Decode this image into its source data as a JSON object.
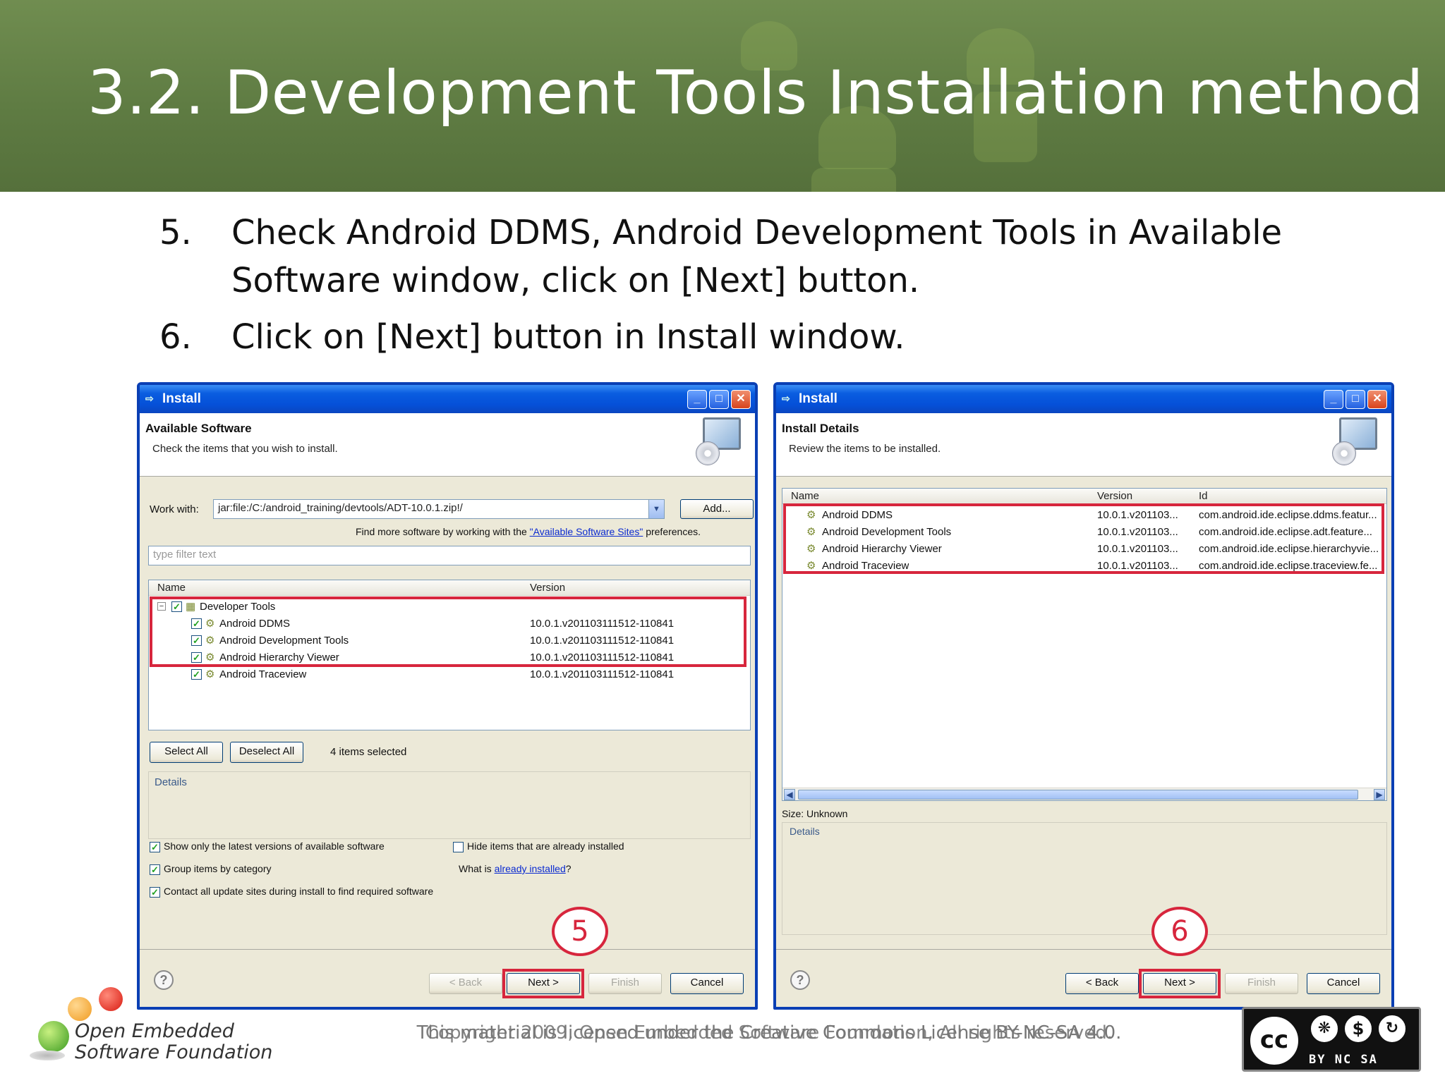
{
  "slide": {
    "title": "3.2. Development Tools Installation method",
    "steps": [
      {
        "num": "5.",
        "text": "Check Android DDMS, Android Development Tools in Available Software window, click on [Next] button."
      },
      {
        "num": "6.",
        "text": "Click on [Next] button in Install window."
      }
    ]
  },
  "left_window": {
    "title": "Install",
    "banner_title": "Available Software",
    "banner_sub": "Check the items that you wish to install.",
    "work_with_label": "Work with:",
    "work_with_value": "jar:file:/C:/android_training/devtools/ADT-10.0.1.zip!/",
    "add_button": "Add...",
    "find_more_prefix": "Find more software by working with the ",
    "find_more_link": "\"Available Software Sites\"",
    "find_more_suffix": " preferences.",
    "filter_placeholder": "type filter text",
    "columns": [
      "Name",
      "Version"
    ],
    "group": "Developer Tools",
    "items": [
      {
        "name": "Android DDMS",
        "version": "10.0.1.v201103111512-110841"
      },
      {
        "name": "Android Development Tools",
        "version": "10.0.1.v201103111512-110841"
      },
      {
        "name": "Android Hierarchy Viewer",
        "version": "10.0.1.v201103111512-110841"
      },
      {
        "name": "Android Traceview",
        "version": "10.0.1.v201103111512-110841"
      }
    ],
    "select_all": "Select All",
    "deselect_all": "Deselect All",
    "selected_count": "4 items selected",
    "details_label": "Details",
    "options": [
      "Show only the latest versions of available software",
      "Group items by category",
      "Contact all update sites during install to find required software"
    ],
    "hide_installed": "Hide items that are already installed",
    "what_is_prefix": "What is ",
    "what_is_link": "already installed",
    "what_is_suffix": "?",
    "back_button": "< Back",
    "next_button": "Next >",
    "finish_button": "Finish",
    "cancel_button": "Cancel",
    "callout": "5"
  },
  "right_window": {
    "title": "Install",
    "banner_title": "Install Details",
    "banner_sub": "Review the items to be installed.",
    "columns": [
      "Name",
      "Version",
      "Id"
    ],
    "items": [
      {
        "name": "Android DDMS",
        "version": "10.0.1.v201103...",
        "id": "com.android.ide.eclipse.ddms.featur..."
      },
      {
        "name": "Android Development Tools",
        "version": "10.0.1.v201103...",
        "id": "com.android.ide.eclipse.adt.feature..."
      },
      {
        "name": "Android Hierarchy Viewer",
        "version": "10.0.1.v201103...",
        "id": "com.android.ide.eclipse.hierarchyvie..."
      },
      {
        "name": "Android Traceview",
        "version": "10.0.1.v201103...",
        "id": "com.android.ide.eclipse.traceview.fe..."
      }
    ],
    "size_label": "Size: Unknown",
    "details_label": "Details",
    "back_button": "< Back",
    "next_button": "Next >",
    "finish_button": "Finish",
    "cancel_button": "Cancel",
    "callout": "6"
  },
  "footer": {
    "logo_line1": "Open Embedded",
    "logo_line2": "Software Foundation",
    "license_text": "This material is licensed under the Creative Commons License BY-NC-SA 4.0.",
    "copyright_text": "Copyright 2009, Open Embedded Software Foundation, All rights reserved.",
    "cc_label": "cc",
    "cc_terms": "BY  NC  SA"
  },
  "colors": {
    "header_green": "#5f7c43",
    "highlight_red": "#d7263d",
    "xp_blue": "#0a46c0"
  }
}
